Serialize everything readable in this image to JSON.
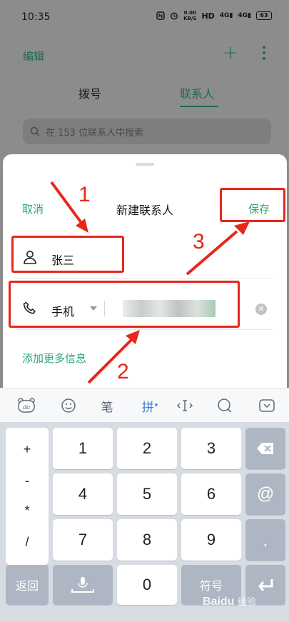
{
  "status_bar": {
    "time": "10:35",
    "speed_value": "0.00",
    "speed_unit": "KB/S",
    "hd_label": "HD",
    "signal1": "4G",
    "signal2": "4G",
    "battery": "63"
  },
  "background_app": {
    "edit_label": "编辑",
    "add_icon": "plus-icon",
    "more_icon": "more-vertical-icon",
    "tabs": [
      {
        "label": "拨号"
      },
      {
        "label": "联系人"
      }
    ],
    "active_tab": 1,
    "search_placeholder": "在 153 位联系人中搜索"
  },
  "sheet": {
    "cancel_label": "取消",
    "title": "新建联系人",
    "save_label": "保存",
    "name_value": "张三",
    "phone_type": "手机",
    "phone_value": "",
    "add_more_label": "添加更多信息",
    "accent_color": "#2fa775"
  },
  "keyboard": {
    "toolbar": {
      "logo_text": "du",
      "brush_label": "笔",
      "pinyin_label": "拼"
    },
    "symbols": [
      "+",
      "-",
      "*",
      "/"
    ],
    "digits_row1": [
      "1",
      "2",
      "3"
    ],
    "digits_row2": [
      "4",
      "5",
      "6"
    ],
    "digits_row3": [
      "7",
      "8",
      "9"
    ],
    "at_key": "@",
    "dot_key": ".",
    "return_label": "返回",
    "zero_key": "0",
    "symbol_label": "符号"
  },
  "annotations": {
    "color": "#e8261c",
    "step1": "1",
    "step2": "2",
    "step3": "3"
  },
  "watermark": {
    "brand": "Baidu",
    "sub": "经验"
  }
}
